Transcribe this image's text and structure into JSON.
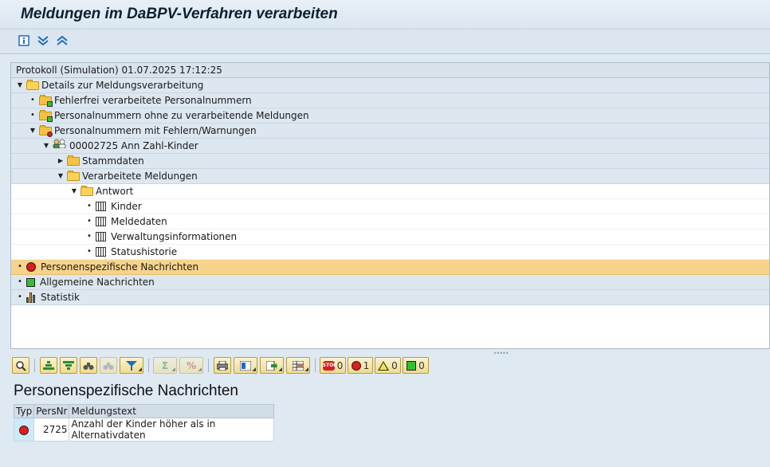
{
  "title": "Meldungen im DaBPV-Verfahren verarbeiten",
  "toolbar": {
    "icons": [
      "info-icon",
      "expand-all-icon",
      "collapse-all-icon"
    ]
  },
  "tree": {
    "header": "Protokoll (Simulation) 01.07.2025 17:12:25",
    "nodes": [
      {
        "label": "Details zur Meldungsverarbeitung"
      },
      {
        "label": "Fehlerfrei verarbeitete Personalnummern"
      },
      {
        "label": "Personalnummern ohne zu verarbeitende Meldungen"
      },
      {
        "label": "Personalnummern mit Fehlern/Warnungen"
      },
      {
        "label": "00002725 Ann Zahl-Kinder"
      },
      {
        "label": "Stammdaten"
      },
      {
        "label": "Verarbeitete Meldungen"
      },
      {
        "label": "Antwort"
      },
      {
        "label": "Kinder"
      },
      {
        "label": "Meldedaten"
      },
      {
        "label": "Verwaltungsinformationen"
      },
      {
        "label": "Statushistorie"
      },
      {
        "label": "Personenspezifische Nachrichten"
      },
      {
        "label": "Allgemeine Nachrichten"
      },
      {
        "label": "Statistik"
      }
    ]
  },
  "msg_toolbar": {
    "counts": {
      "stop": "0",
      "error": "1",
      "warning": "0",
      "success": "0"
    }
  },
  "messages": {
    "title": "Personenspezifische Nachrichten",
    "columns": [
      "Typ",
      "PersNr",
      "Meldungstext"
    ],
    "rows": [
      {
        "typ_icon": "error-red-icon",
        "persnr": "2725",
        "text": "Anzahl der Kinder höher als in Alternativdaten"
      }
    ]
  },
  "colors": {
    "background": "#dfe9f2",
    "selected_row": "#f7d48c",
    "error": "#e51b1b",
    "success": "#2ec32e",
    "folder": "#f5c341"
  }
}
